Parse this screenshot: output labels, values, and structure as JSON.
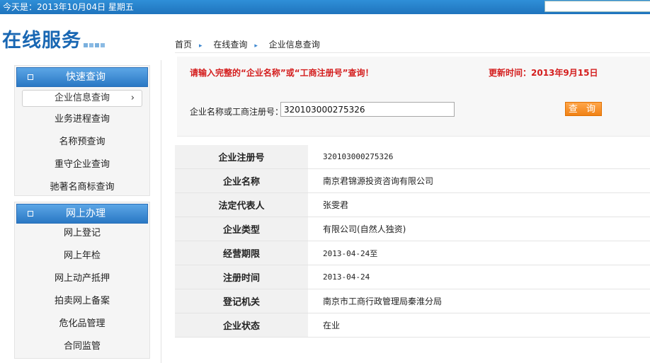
{
  "topbar": {
    "date_text": "今天是：2013年10月04日 星期五",
    "search_value": ""
  },
  "brand": {
    "title": "在线服务"
  },
  "sidebar": {
    "quick": {
      "header": "快速查询",
      "items": [
        "企业信息查询",
        "业务进程查询",
        "名称预查询",
        "重守企业查询",
        "驰著名商标查询"
      ],
      "active_index": 0
    },
    "online": {
      "header": "网上办理",
      "items": [
        "网上登记",
        "网上年检",
        "网上动产抵押",
        "拍卖网上备案",
        "危化品管理",
        "合同监管"
      ]
    }
  },
  "breadcrumb": [
    "首页",
    "在线查询",
    "企业信息查询"
  ],
  "query": {
    "notice": "请输入完整的“企业名称”或“工商注册号”查询！",
    "update_time": "更新时间：2013年9月15日",
    "label": "企业名称或工商注册号：",
    "value": "320103000275326",
    "button": "查 询"
  },
  "result": {
    "rows": [
      {
        "key": "企业注册号",
        "value": "320103000275326"
      },
      {
        "key": "企业名称",
        "value": "南京君锦源投资咨询有限公司"
      },
      {
        "key": "法定代表人",
        "value": "张雯君"
      },
      {
        "key": "企业类型",
        "value": "有限公司(自然人独资)"
      },
      {
        "key": "经营期限",
        "value": "2013-04-24至"
      },
      {
        "key": "注册时间",
        "value": "2013-04-24"
      },
      {
        "key": "登记机关",
        "value": "南京市工商行政管理局秦淮分局"
      },
      {
        "key": "企业状态",
        "value": "在业"
      }
    ]
  },
  "colors": {
    "accent_blue": "#2a78c4",
    "notice_red": "#d41d1d",
    "button_orange": "#f08216"
  }
}
